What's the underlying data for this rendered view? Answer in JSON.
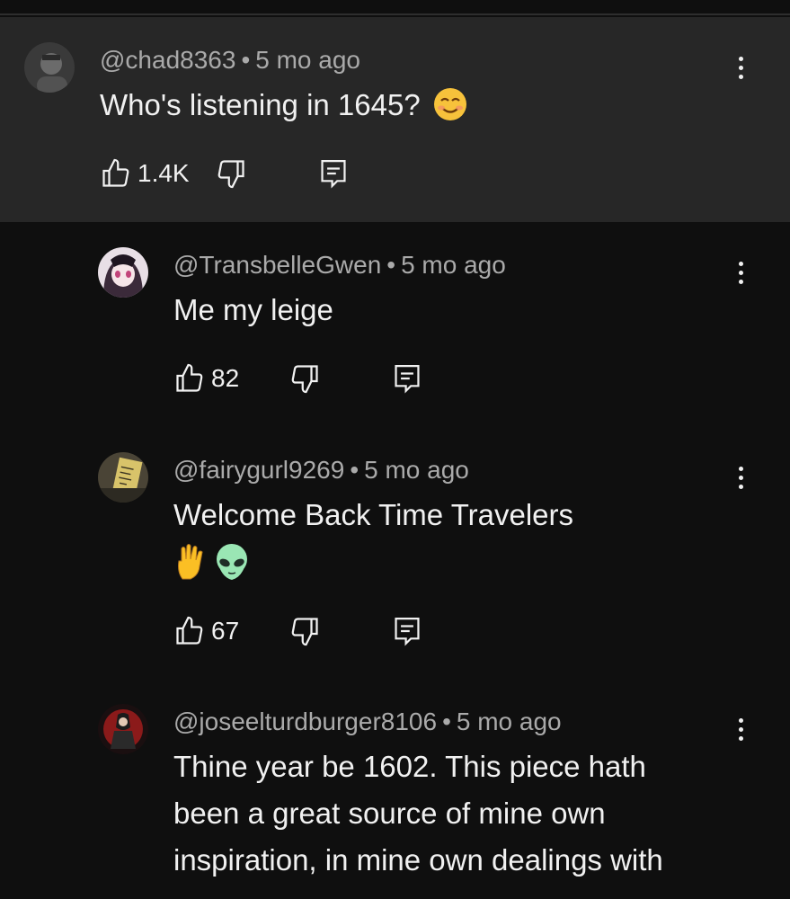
{
  "comments": [
    {
      "handle": "@chad8363",
      "time": "5 mo ago",
      "text": "Who's listening in 1645?",
      "emoji": "smiling-face-emoji",
      "likes": "1.4K"
    },
    {
      "handle": "@TransbelleGwen",
      "time": "5 mo ago",
      "text": "Me my leige",
      "likes": "82"
    },
    {
      "handle": "@fairygurl9269",
      "time": "5 mo ago",
      "text": "Welcome Back Time Travelers",
      "emoji": "vulcan-salute-and-alien-emoji",
      "likes": "67"
    },
    {
      "handle": "@joseelturdburger8106",
      "time": "5 mo ago",
      "text_lines": [
        "Thine year be 1602. This piece hath",
        "been a great source of mine own",
        "inspiration, in mine own dealings with"
      ]
    }
  ],
  "separator": "•",
  "icons": {
    "like": "thumbs-up-icon",
    "dislike": "thumbs-down-icon",
    "reply": "reply-icon",
    "more": "more-vert-icon"
  },
  "colors": {
    "background": "#0f0f0f",
    "highlight": "#272727",
    "meta": "#aaaaaa",
    "text": "#f1f1f1"
  }
}
